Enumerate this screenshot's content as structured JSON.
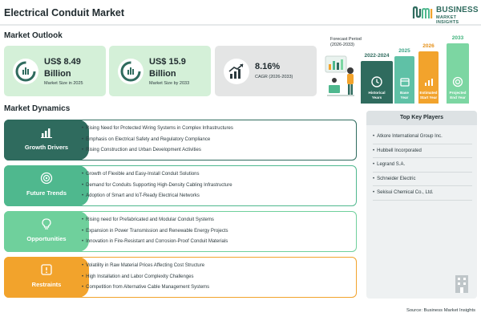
{
  "header": {
    "title": "Electrical Conduit Market",
    "logo_line1": "BUSINESS",
    "logo_line2": "MARKET INSIGHTS"
  },
  "market_outlook": {
    "section_title": "Market Outlook",
    "cards": [
      {
        "value_line1": "US$ 8.49",
        "value_line2": "Billion",
        "label": "Market Size in 2025",
        "icon": "chart-pie-icon",
        "bg": "#d4f0d8"
      },
      {
        "value_line1": "US$ 15.9",
        "value_line2": "Billion",
        "label": "Market Size by 2033",
        "icon": "chart-pie-icon",
        "bg": "#d4f0d8"
      },
      {
        "value": "8.16%",
        "label": "CAGR (2026-2033)",
        "icon": "trend-up-icon",
        "bg": "#e4e5e5"
      }
    ]
  },
  "forecast": {
    "label_line1": "Forecast Period",
    "label_line2": "(2026-2033)",
    "columns": [
      {
        "year": "2022-2024",
        "caption_line1": "Historical",
        "caption_line2": "Years",
        "color": "#2f6b5e",
        "year_color": "#2f6b5e",
        "icon": "history-icon"
      },
      {
        "year": "2025",
        "caption_line1": "Base",
        "caption_line2": "Year",
        "color": "#5fc1a6",
        "year_color": "#3aa386",
        "icon": "calendar-icon"
      },
      {
        "year": "2026",
        "caption_line1": "Estimated",
        "caption_line2": "Start Year",
        "color": "#f2a32c",
        "year_color": "#e58f16",
        "icon": "chart-icon"
      },
      {
        "year": "2033",
        "caption_line1": "Projected",
        "caption_line2": "End Year",
        "color": "#7cd6a2",
        "year_color": "#3db27a",
        "icon": "target-icon"
      }
    ]
  },
  "dynamics": {
    "section_title": "Market Dynamics",
    "rows": [
      {
        "label": "Growth Drivers",
        "icon": "bar-chart-icon",
        "color": "#2f6b5e",
        "border": "#2f6b5e",
        "items": [
          "Rising Need for Protected Wiring Systems in Complex Infrastructures",
          "Emphasis on Electrical Safety and Regulatory Compliance",
          "Rising Construction and Urban Development Activities"
        ]
      },
      {
        "label": "Future Trends",
        "icon": "target-icon",
        "color": "#4fb88e",
        "border": "#4fb88e",
        "items": [
          "Growth of Flexible and Easy-Install Conduit Solutions",
          "Demand for Conduits Supporting High-Density Cabling Infrastructure",
          "Adoption of Smart and IoT-Ready Electrical Networks"
        ]
      },
      {
        "label": "Opportunities",
        "icon": "lightbulb-icon",
        "color": "#6fd09c",
        "border": "#6fd09c",
        "items": [
          "Rising need for Prefabricated and Modular Conduit Systems",
          "Expansion in Power Transmission and Renewable Energy Projects",
          "Innovation in Fire-Resistant and Corrosion-Proof Conduit Materials"
        ]
      },
      {
        "label": "Restraints",
        "icon": "warning-icon",
        "color": "#f2a32c",
        "border": "#f2a32c",
        "items": [
          "Volatility in Raw Material Prices Affecting Cost Structure",
          "High Installation and Labor Complexity Challenges",
          "Competition from Alternative Cable Management Systems"
        ]
      }
    ]
  },
  "players": {
    "title": "Top Key Players",
    "items": [
      "Atkore International Group Inc.",
      "Hubbell Incorporated",
      "Legrand S.A.",
      "Schneider Electric",
      "Sekisui Chemical Co., Ltd."
    ]
  },
  "source": "Source: Business Market Insights"
}
